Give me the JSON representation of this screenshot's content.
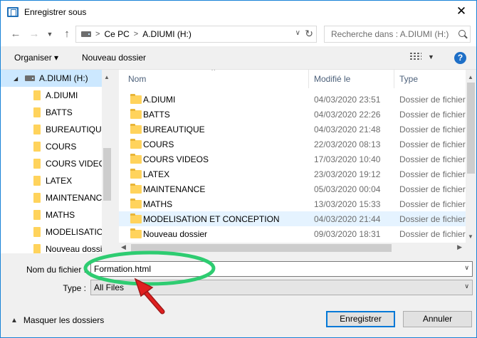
{
  "window": {
    "title": "Enregistrer sous",
    "close_glyph": "✕"
  },
  "address_bar": {
    "crumbs": [
      "Ce PC",
      "A.DIUMI (H:)"
    ],
    "search_placeholder": "Recherche dans : A.DIUMI (H:)"
  },
  "toolbar": {
    "organize_label": "Organiser ▾",
    "new_folder_label": "Nouveau dossier",
    "help_label": "?"
  },
  "sidebar": {
    "drive_label": "A.DIUMI (H:)",
    "items": [
      "A.DIUMI",
      "BATTS",
      "BUREAUTIQUE",
      "COURS",
      "COURS VIDEOS",
      "LATEX",
      "MAINTENANCE",
      "MATHS",
      "MODELISATION",
      "Nouveau dossier"
    ]
  },
  "file_list": {
    "columns": {
      "name": "Nom",
      "modified": "Modifié le",
      "type": "Type"
    },
    "highlighted_row": 8,
    "rows": [
      {
        "name": "A.DIUMI",
        "modified": "04/03/2020 23:51",
        "type": "Dossier de fichiers"
      },
      {
        "name": "BATTS",
        "modified": "04/03/2020 22:26",
        "type": "Dossier de fichiers"
      },
      {
        "name": "BUREAUTIQUE",
        "modified": "04/03/2020 21:48",
        "type": "Dossier de fichiers"
      },
      {
        "name": "COURS",
        "modified": "22/03/2020 08:13",
        "type": "Dossier de fichiers"
      },
      {
        "name": "COURS VIDEOS",
        "modified": "17/03/2020 10:40",
        "type": "Dossier de fichiers"
      },
      {
        "name": "LATEX",
        "modified": "23/03/2020 19:12",
        "type": "Dossier de fichiers"
      },
      {
        "name": "MAINTENANCE",
        "modified": "05/03/2020 00:04",
        "type": "Dossier de fichiers"
      },
      {
        "name": "MATHS",
        "modified": "13/03/2020 15:33",
        "type": "Dossier de fichiers"
      },
      {
        "name": "MODELISATION ET CONCEPTION",
        "modified": "04/03/2020 21:44",
        "type": "Dossier de fichiers"
      },
      {
        "name": "Nouveau dossier",
        "modified": "09/03/2020 18:31",
        "type": "Dossier de fichiers"
      }
    ]
  },
  "form": {
    "filename_label": "Nom du fichier :",
    "filename_value": "Formation.html",
    "filetype_label": "Type :",
    "filetype_value": "All Files"
  },
  "footer": {
    "hide_folders_label": "Masquer les dossiers",
    "save_label": "Enregistrer",
    "cancel_label": "Annuler"
  },
  "colors": {
    "accent": "#0078d7",
    "selection": "#cce8ff",
    "hover_row": "#e5f3ff",
    "annotation_green": "#2ecc71",
    "annotation_red": "#e02020"
  }
}
